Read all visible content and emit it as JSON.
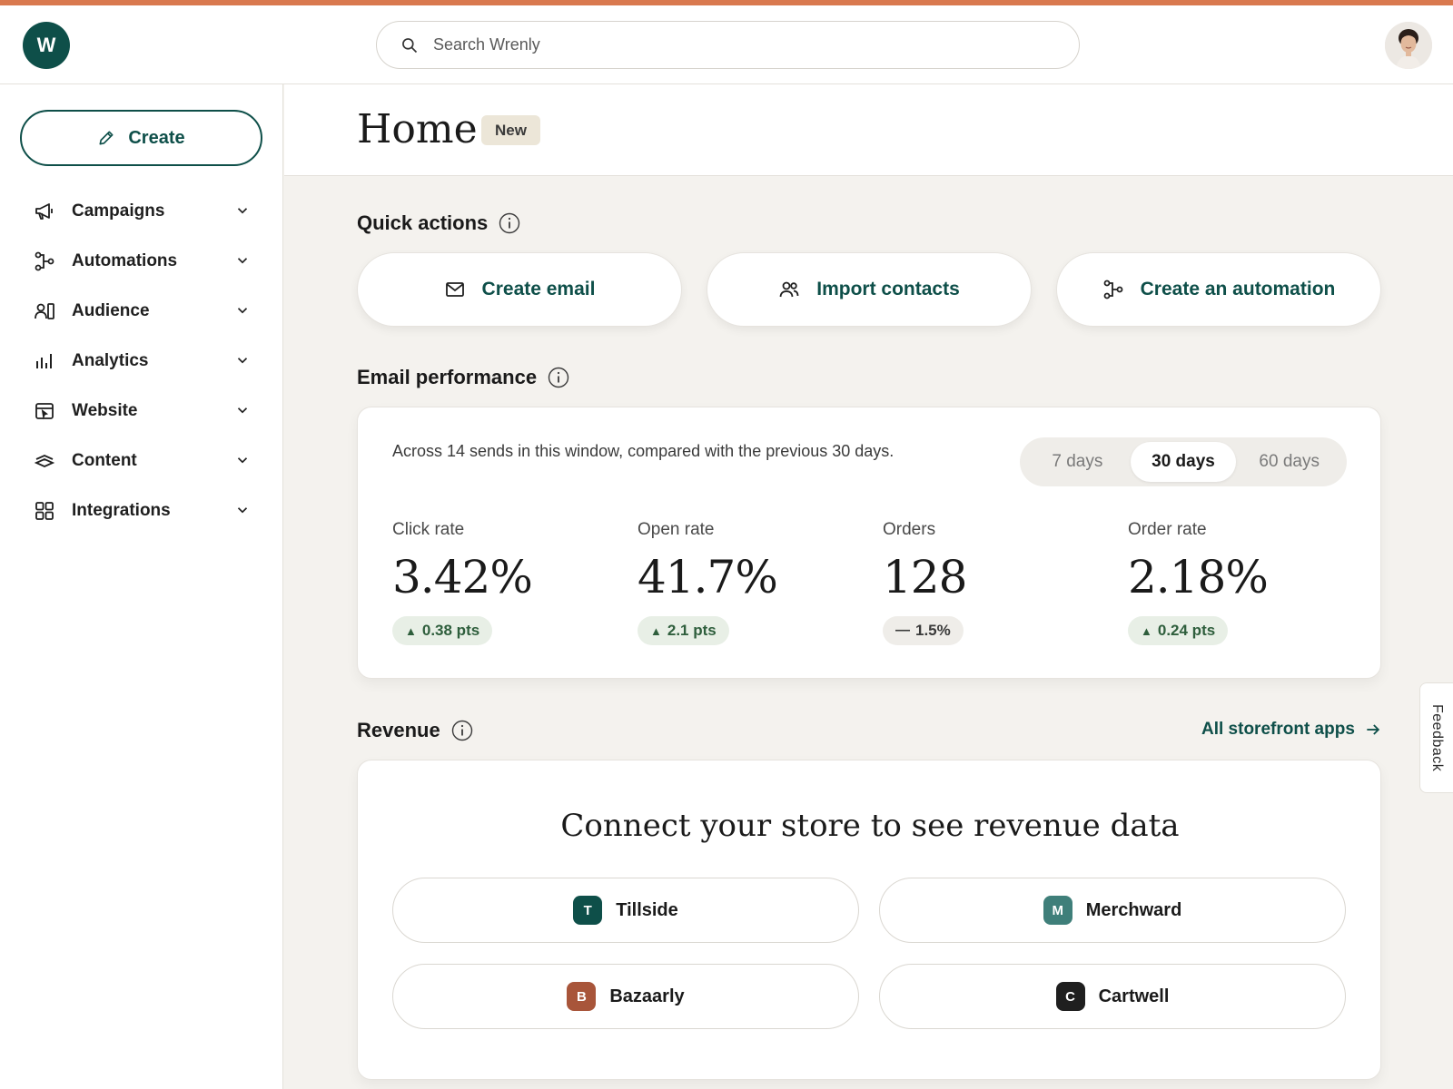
{
  "app": {
    "logo_letter": "W",
    "accent_color": "#d9794f",
    "brand_color": "#0e4f49"
  },
  "search": {
    "placeholder": "Search Wrenly"
  },
  "sidebar": {
    "create_label": "Create",
    "items": [
      {
        "label": "Campaigns",
        "icon": "megaphone-icon"
      },
      {
        "label": "Automations",
        "icon": "flow-icon"
      },
      {
        "label": "Audience",
        "icon": "audience-icon"
      },
      {
        "label": "Analytics",
        "icon": "bar-chart-icon"
      },
      {
        "label": "Website",
        "icon": "website-icon"
      },
      {
        "label": "Content",
        "icon": "content-icon"
      },
      {
        "label": "Integrations",
        "icon": "grid-icon"
      }
    ]
  },
  "header": {
    "title": "Home",
    "badge": "New"
  },
  "quick_actions": {
    "title": "Quick actions",
    "buttons": [
      {
        "label": "Create email",
        "icon": "mail-icon"
      },
      {
        "label": "Import contacts",
        "icon": "contacts-icon"
      },
      {
        "label": "Create an automation",
        "icon": "flow-icon"
      }
    ]
  },
  "email_performance": {
    "title": "Email performance",
    "description": "Across 14 sends in this window, compared with the previous 30 days.",
    "ranges": [
      "7 days",
      "30 days",
      "60 days"
    ],
    "selected_range": "30 days",
    "metrics": [
      {
        "label": "Click rate",
        "value": "3.42%",
        "delta": "0.38 pts",
        "trend": "up"
      },
      {
        "label": "Open rate",
        "value": "41.7%",
        "delta": "2.1 pts",
        "trend": "up"
      },
      {
        "label": "Orders",
        "value": "128",
        "delta": "1.5%",
        "trend": "flat"
      },
      {
        "label": "Order rate",
        "value": "2.18%",
        "delta": "0.24 pts",
        "trend": "up"
      }
    ]
  },
  "revenue": {
    "title": "Revenue",
    "link_label": "All storefront apps",
    "card_title": "Connect your store to see revenue data",
    "stores": [
      {
        "name": "Tillside",
        "letter": "T",
        "color": "#0e4f49"
      },
      {
        "name": "Merchward",
        "letter": "M",
        "color": "#3f7f7a"
      },
      {
        "name": "Bazaarly",
        "letter": "B",
        "color": "#a8553a"
      },
      {
        "name": "Cartwell",
        "letter": "C",
        "color": "#1f1f1f"
      }
    ]
  },
  "feedback": {
    "label": "Feedback"
  }
}
